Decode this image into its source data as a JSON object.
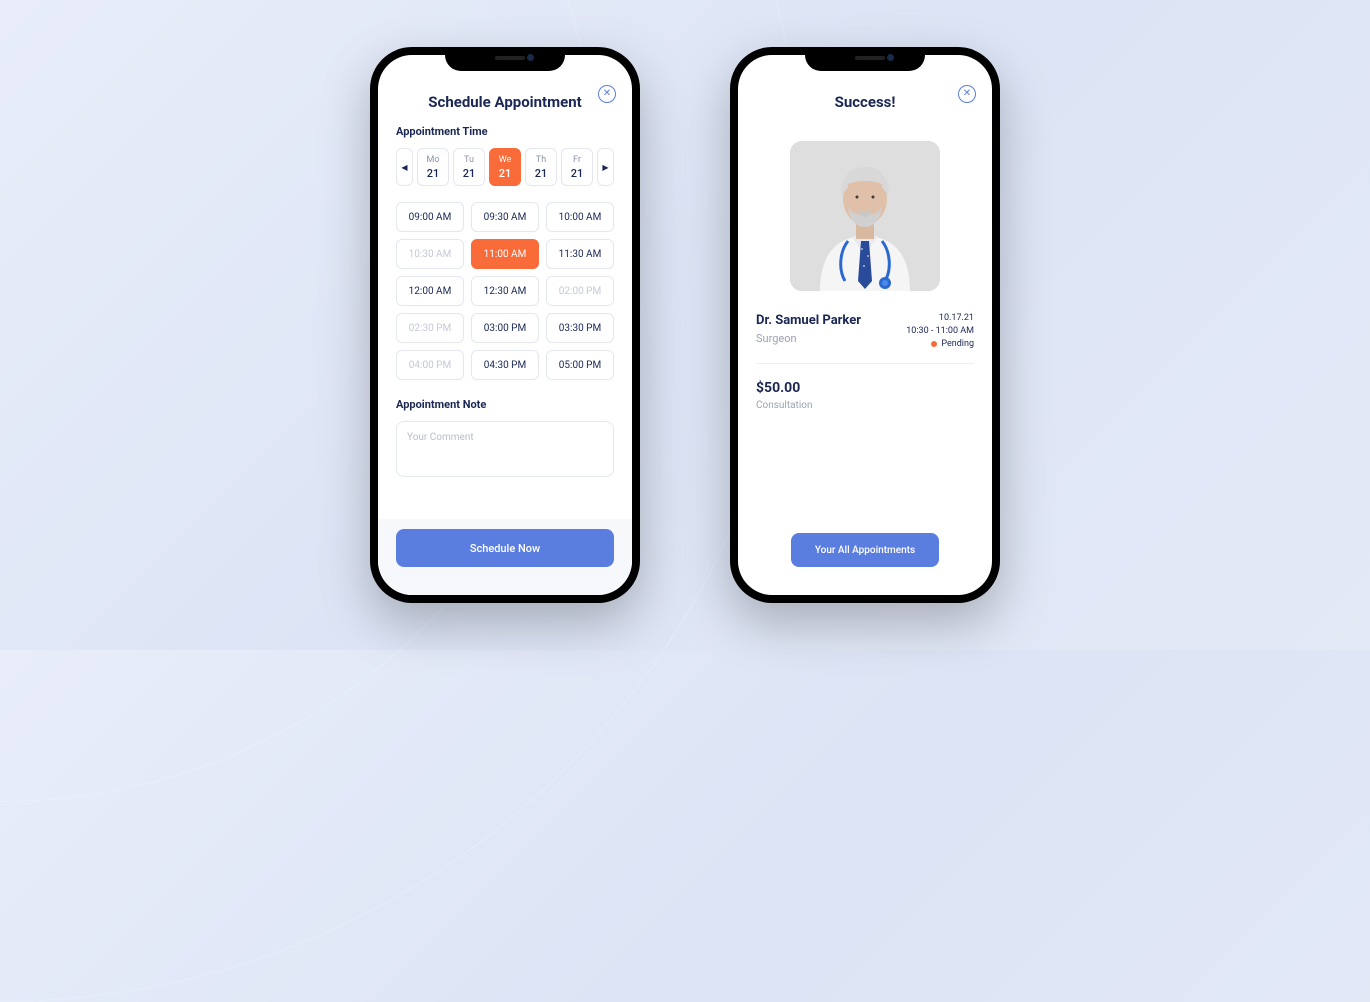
{
  "schedule": {
    "title": "Schedule Appointment",
    "section_time": "Appointment Time",
    "section_note": "Appointment Note",
    "note_placeholder": "Your Comment",
    "submit_label": "Schedule Now",
    "selected_day_index": 2,
    "selected_time_index": 4,
    "days": [
      {
        "dow": "Mo",
        "num": "21"
      },
      {
        "dow": "Tu",
        "num": "21"
      },
      {
        "dow": "We",
        "num": "21"
      },
      {
        "dow": "Th",
        "num": "21"
      },
      {
        "dow": "Fr",
        "num": "21"
      }
    ],
    "slots": [
      {
        "label": "09:00 AM",
        "state": "available"
      },
      {
        "label": "09:30 AM",
        "state": "available"
      },
      {
        "label": "10:00 AM",
        "state": "available"
      },
      {
        "label": "10:30 AM",
        "state": "disabled"
      },
      {
        "label": "11:00 AM",
        "state": "selected"
      },
      {
        "label": "11:30 AM",
        "state": "available"
      },
      {
        "label": "12:00 AM",
        "state": "available"
      },
      {
        "label": "12:30 AM",
        "state": "available"
      },
      {
        "label": "02:00 PM",
        "state": "disabled"
      },
      {
        "label": "02:30 PM",
        "state": "disabled"
      },
      {
        "label": "03:00 PM",
        "state": "available"
      },
      {
        "label": "03:30 PM",
        "state": "available"
      },
      {
        "label": "04:00 PM",
        "state": "disabled"
      },
      {
        "label": "04:30 PM",
        "state": "available"
      },
      {
        "label": "05:00 PM",
        "state": "available"
      }
    ]
  },
  "success": {
    "title": "Success!",
    "doctor_name": "Dr. Samuel Parker",
    "doctor_role": "Surgeon",
    "date": "10.17.21",
    "time": "10:30 - 11:00 AM",
    "status": "Pending",
    "price": "$50.00",
    "price_label": "Consultation",
    "cta_label": "Your All Appointments"
  },
  "colors": {
    "accent": "#fa6b3a",
    "primary": "#5a7de0",
    "text": "#1a2754"
  }
}
